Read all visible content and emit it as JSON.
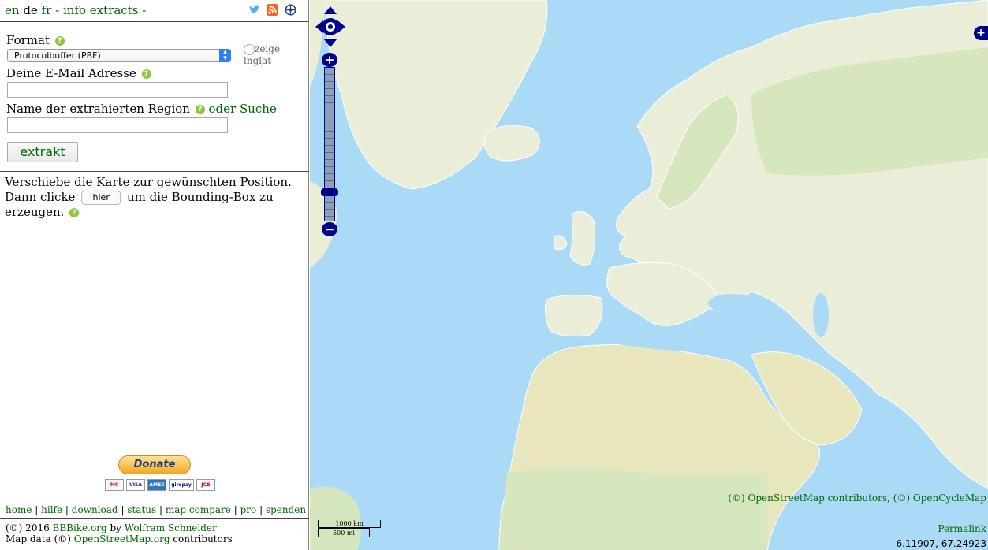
{
  "top_nav": {
    "lang_en": "en",
    "lang_de": "de",
    "lang_fr": "fr",
    "dash1": "-",
    "info_link": "info",
    "extracts_link": "extracts",
    "dash2": "-"
  },
  "icons": [
    "twitter-icon",
    "rss-icon",
    "locate-icon",
    "help-icon",
    "select-arrow-icon",
    "pan-control-icon"
  ],
  "form": {
    "format_label": "Format",
    "format_value": "Protocolbuffer (PBF)",
    "show_inglat_label": "zeige lnglat",
    "email_label": "Deine E-Mail Adresse",
    "email_value": "",
    "region_label": "Name der extrahierten Region",
    "search_link": "oder Suche",
    "region_value": "",
    "extract_button": "extrakt"
  },
  "instructions": {
    "line1": "Verschiebe die Karte zur gewünschten Position.",
    "line2_before": "Dann clicke",
    "hier_button": "hier",
    "line2_after": "um die Bounding-Box zu erzeugen."
  },
  "donate": {
    "button": "Donate",
    "cards": [
      "MC",
      "VISA",
      "AMEX",
      "giropay",
      "JCB"
    ]
  },
  "footer_links": [
    "home",
    "hilfe",
    "download",
    "status",
    "map compare",
    "pro",
    "spenden"
  ],
  "footer_sep": "|",
  "credits": {
    "copyright": "(©) 2016",
    "bbbike": "BBBike.org",
    "by": "by",
    "author": "Wolfram Schneider",
    "mapdata": "Map data (©)",
    "osm": "OpenStreetMap.org",
    "contributors": "contributors"
  },
  "map": {
    "zoom_in": "+",
    "zoom_out": "−",
    "layer_switcher": "+",
    "attribution_osm": "(©) OpenStreetMap contributors",
    "attribution_sep": ",",
    "attribution_ocm": "(©) OpenCycleMap",
    "permalink": "Permalink",
    "coordinates": "-6.11907, 67.24923",
    "scale_km": "1000 km",
    "scale_mi": "500 mi",
    "colors": {
      "water": "#aadaf6",
      "land": "#eaeed9",
      "desert": "#e8e6bd",
      "forest": "#d6e6bf",
      "control": "#00008b",
      "link": "#006600"
    }
  }
}
